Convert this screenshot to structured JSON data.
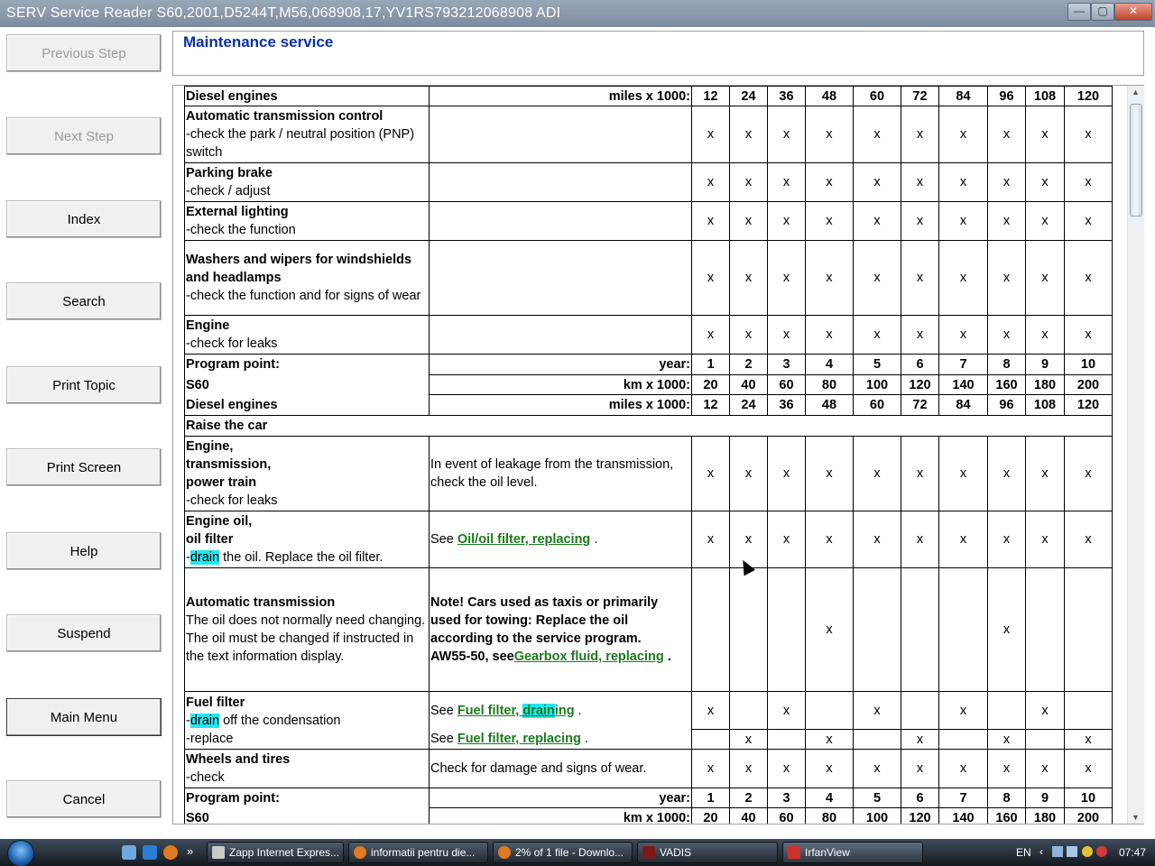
{
  "window": {
    "title": "SERV Service Reader S60,2001,D5244T,M56,068908,17,YV1RS793212068908 ADI",
    "minimize": "—",
    "maximize": "▢",
    "close": "✕"
  },
  "nav": {
    "previous": "Previous Step",
    "next": "Next Step",
    "index": "Index",
    "search": "Search",
    "print_topic": "Print Topic",
    "print_screen": "Print Screen",
    "help": "Help",
    "suspend": "Suspend",
    "main_menu": "Main Menu",
    "cancel": "Cancel"
  },
  "header": {
    "title": "Maintenance service"
  },
  "table": {
    "diesel_engines": "Diesel engines",
    "miles_label": "miles x 1000:",
    "year_label": "year:",
    "km_label": "km x 1000:",
    "program_point": "Program point:",
    "model": "S60",
    "raise_the_car": "Raise the car",
    "x": "x",
    "miles": [
      "12",
      "24",
      "36",
      "48",
      "60",
      "72",
      "84",
      "96",
      "108",
      "120"
    ],
    "years": [
      "1",
      "2",
      "3",
      "4",
      "5",
      "6",
      "7",
      "8",
      "9",
      "10"
    ],
    "km": [
      "20",
      "40",
      "60",
      "80",
      "100",
      "120",
      "140",
      "160",
      "180",
      "200"
    ],
    "tasks": {
      "atc_title": "Automatic transmission control",
      "atc_desc": "-check the park / neutral position (PNP) switch",
      "pb_title": "Parking brake",
      "pb_desc": "-check / adjust",
      "el_title": "External lighting",
      "el_desc": "-check the function",
      "ww_title": "Washers and wipers for windshields and headlamps",
      "ww_desc": "-check the function and for signs of wear",
      "eng_title": "Engine",
      "eng_desc": "-check for leaks",
      "etp_title1": "Engine,",
      "etp_title2": "transmission,",
      "etp_title3": "power train",
      "etp_desc": "-check for leaks",
      "etp_note": "In event of leakage from the transmission, check the oil level.",
      "oil_title1": "Engine oil,",
      "oil_title2": "oil filter",
      "oil_dash": "-",
      "oil_drain": "drain",
      "oil_rest": " the oil. Replace the oil filter.",
      "oil_see": "See ",
      "oil_link": "Oil/oil filter, replacing",
      "dot": " .",
      "at_title": "Automatic transmission",
      "at_desc1": "The oil does not normally need changing.",
      "at_desc2": "The oil must be changed if instructed in the text information display.",
      "at_note": "Note! Cars used as taxis or primarily used for towing: Replace the oil according to the service program.",
      "at_aw": "AW55-50, see",
      "at_link": "Gearbox fluid, replacing",
      "ff_title": "Fuel filter",
      "ff_dash": "-",
      "ff_drain": "drain",
      "ff_rest": " off the condensation",
      "ff_replace": "-replace",
      "ff_see": "See ",
      "ff_link1a": "Fuel filter, ",
      "ff_link1b": "drain",
      "ff_link1c": "ing",
      "ff_link2": "Fuel filter, replacing",
      "wt_title": "Wheels and tires",
      "wt_desc": "-check",
      "wt_note": "Check for damage and signs of wear."
    }
  },
  "taskbar": {
    "items": [
      "Zapp Internet Expres...",
      "informatii pentru die...",
      "2% of 1 file - Downlo...",
      "VADIS",
      "IrfanView"
    ],
    "lang": "EN",
    "time": "07:47",
    "more": "»"
  }
}
